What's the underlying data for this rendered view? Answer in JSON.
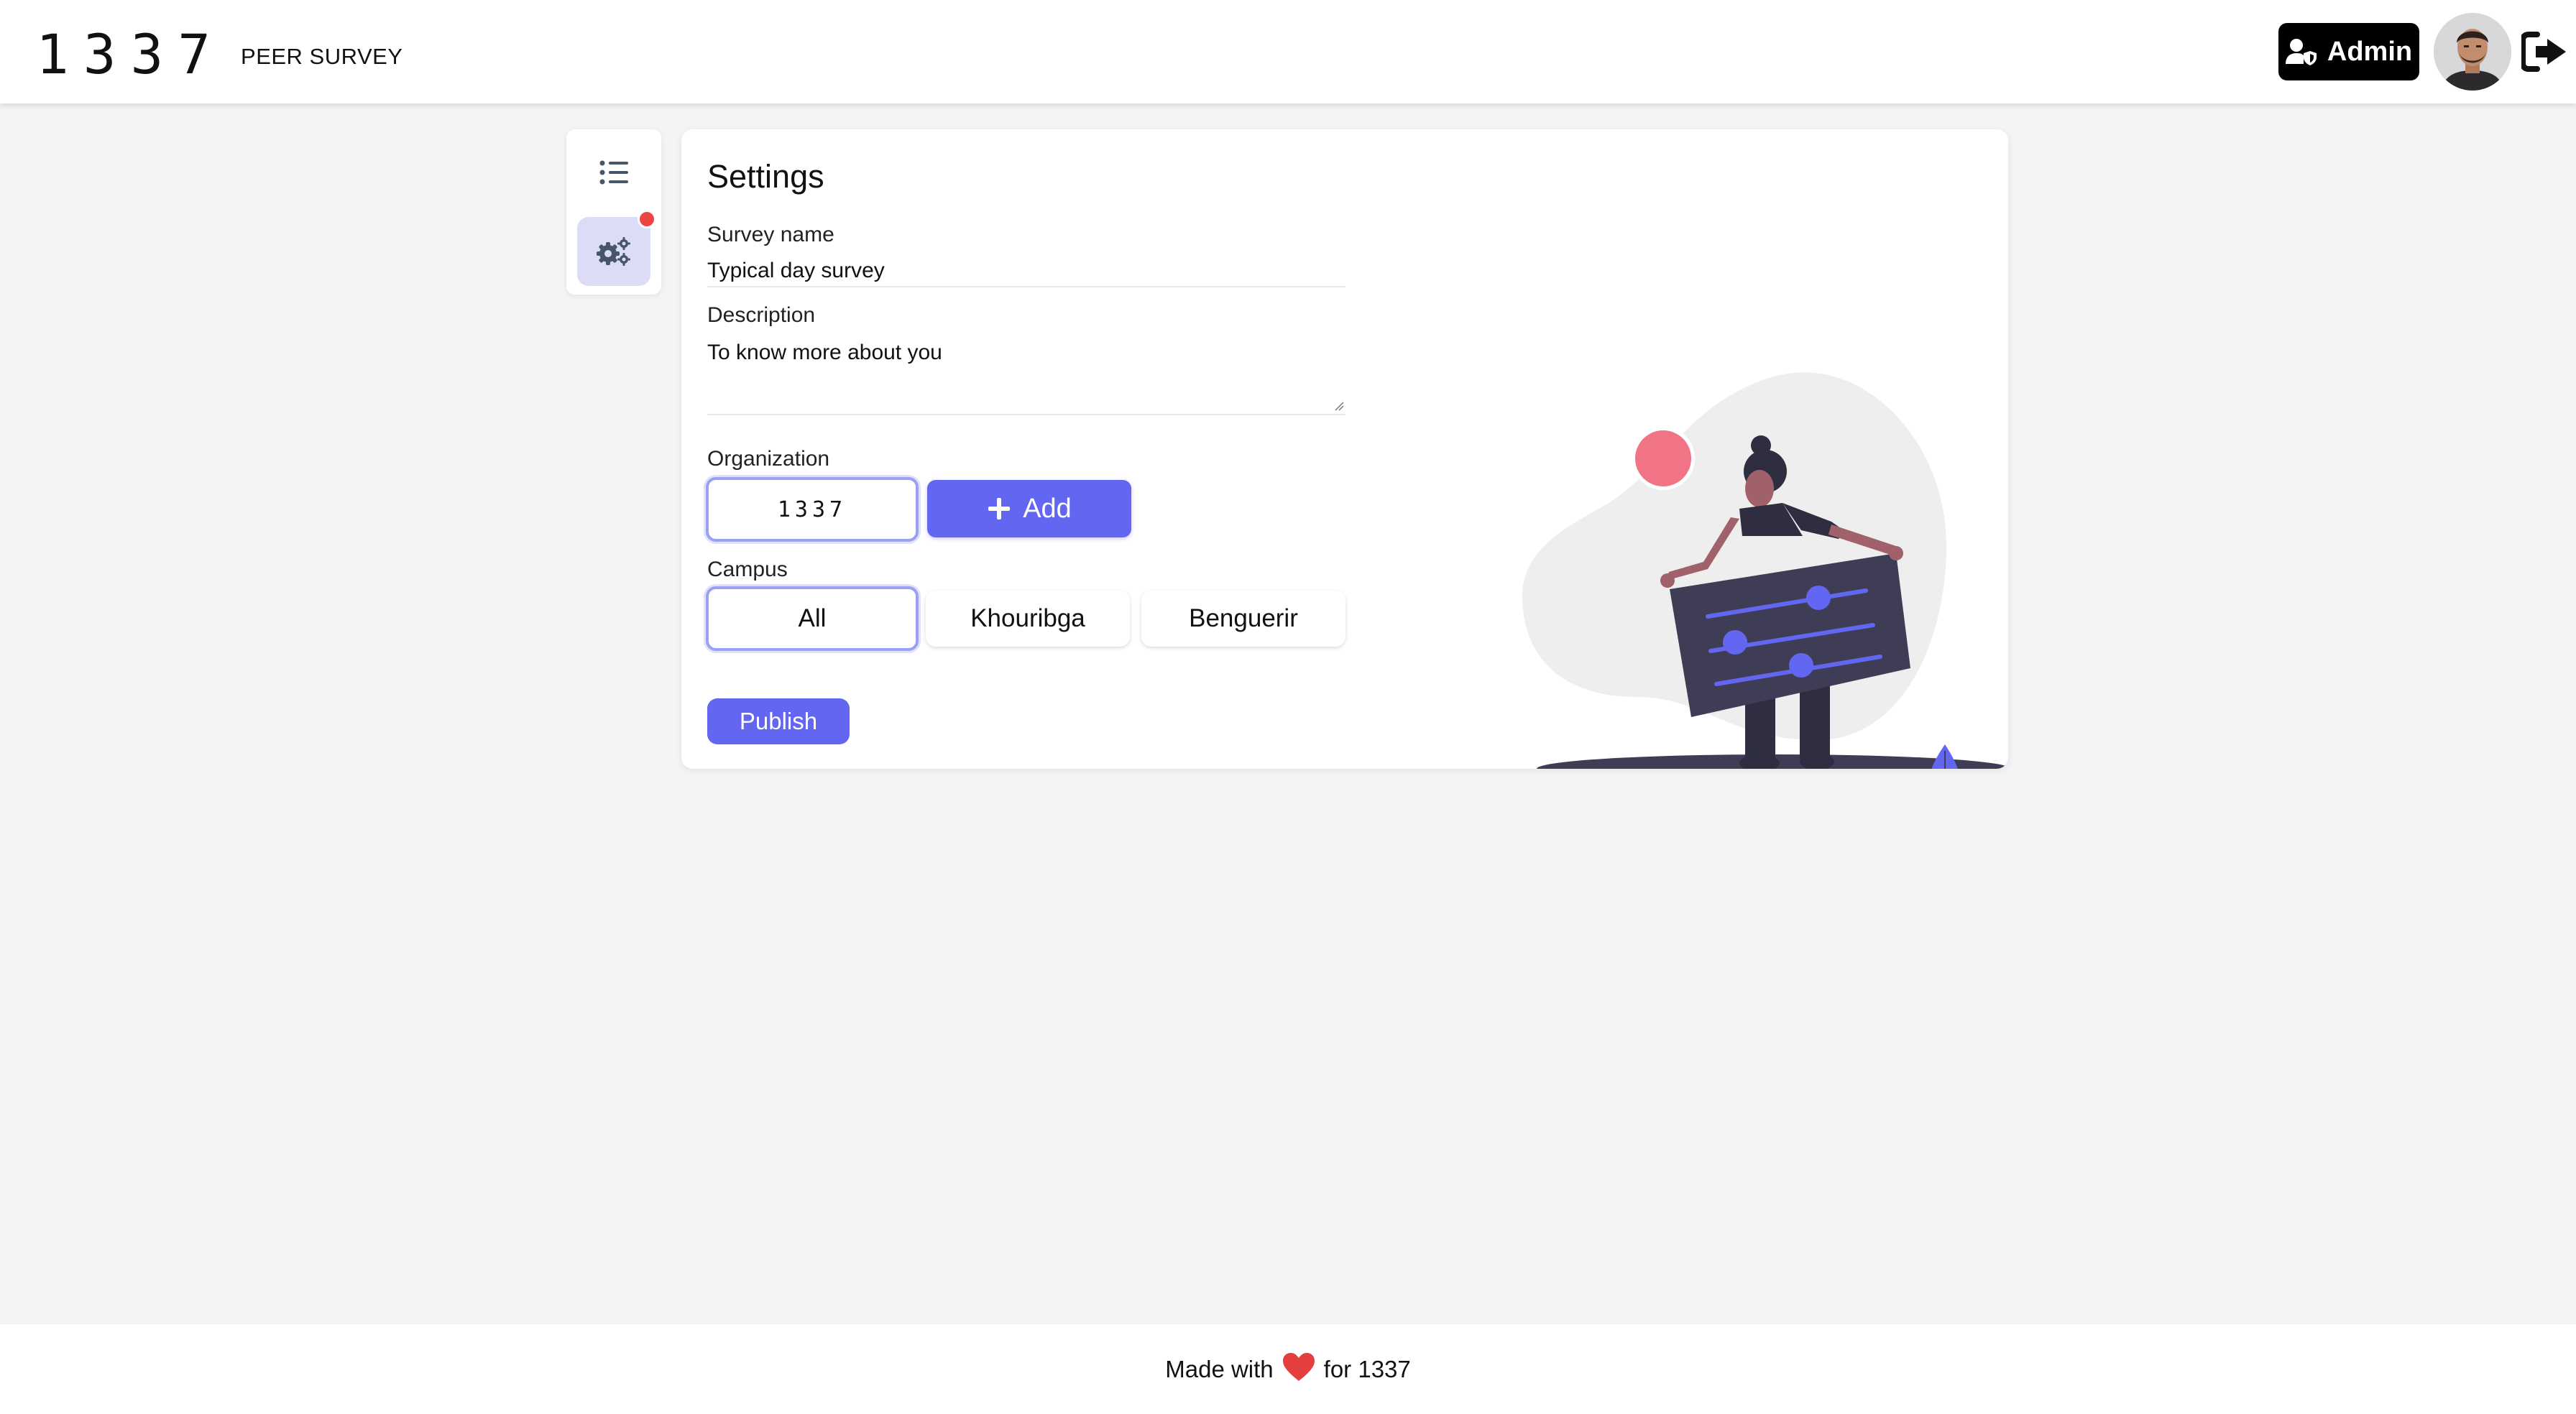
{
  "header": {
    "logo_mark": "1337",
    "app_title": "PEER SURVEY",
    "admin_label": "Admin",
    "icons": {
      "admin": "user-shield-icon",
      "logout": "sign-out-icon"
    }
  },
  "sidebar": {
    "items": [
      {
        "icon": "list-icon",
        "active": false
      },
      {
        "icon": "cogs-icon",
        "active": true,
        "notification": true
      }
    ]
  },
  "settings": {
    "title": "Settings",
    "survey_name": {
      "label": "Survey name",
      "value": "Typical day survey"
    },
    "description": {
      "label": "Description",
      "value": "To know more about you"
    },
    "organization": {
      "label": "Organization",
      "selected": "1337",
      "add_label": "Add"
    },
    "campus": {
      "label": "Campus",
      "options": [
        "All",
        "Khouribga",
        "Benguerir"
      ],
      "selected": "All"
    },
    "publish_label": "Publish"
  },
  "footer": {
    "prefix": "Made with",
    "suffix": "for 1337",
    "icon": "heart-icon"
  },
  "colors": {
    "accent": "#6366f1",
    "background": "#f3f4f6",
    "notification": "#ef4444",
    "heart": "#e53e3e",
    "illustration_accent": "#f07386"
  }
}
